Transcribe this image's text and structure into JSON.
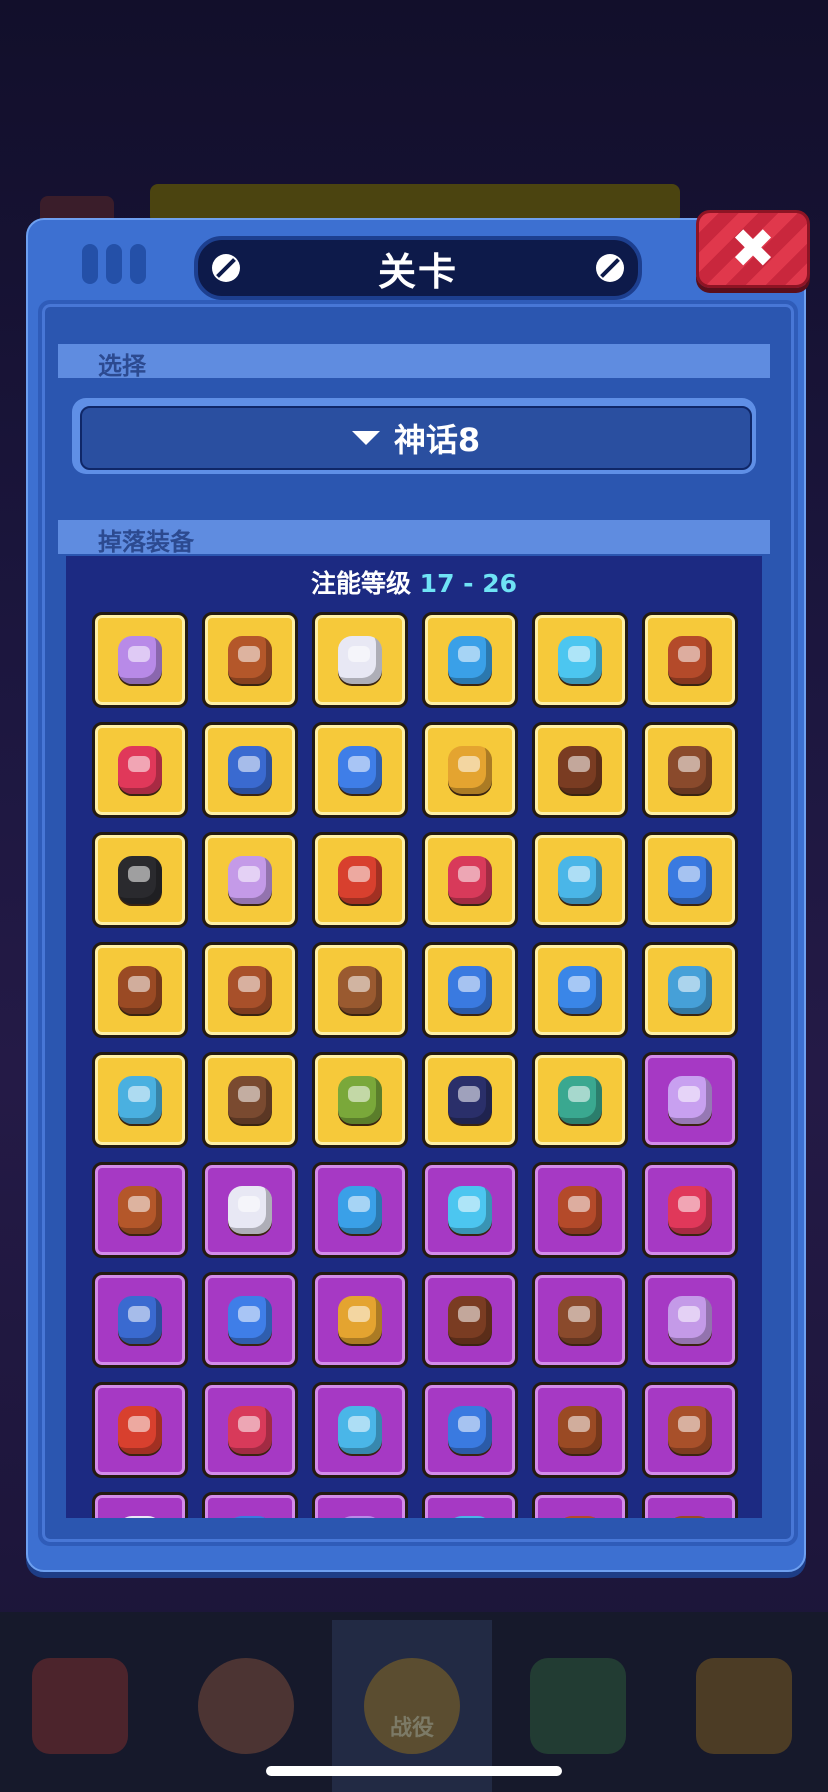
{
  "modal": {
    "title": "关卡",
    "select_section_label": "选择",
    "selected_stage": "神话8",
    "drops_section_label": "掉落装备",
    "level_prefix": "注能等级",
    "level_range": "17 - 26"
  },
  "bottom_nav": {
    "active_label": "战役"
  },
  "items": [
    {
      "icon": "gadget-icon",
      "rarity": "gold",
      "color": "#b88ae8"
    },
    {
      "icon": "shoulder-pad-icon",
      "rarity": "gold",
      "color": "#b4572a"
    },
    {
      "icon": "vest-icon",
      "rarity": "gold",
      "color": "#e8e8f4"
    },
    {
      "icon": "armor-icon",
      "rarity": "gold",
      "color": "#3aa0e8"
    },
    {
      "icon": "goggles-icon",
      "rarity": "gold",
      "color": "#4cc6f0"
    },
    {
      "icon": "cowboy-hat-icon",
      "rarity": "gold",
      "color": "#b44a2a"
    },
    {
      "icon": "headphones-icon",
      "rarity": "gold",
      "color": "#e0385a"
    },
    {
      "icon": "police-cap-icon",
      "rarity": "gold",
      "color": "#3a6ad0"
    },
    {
      "icon": "blue-glove-icon",
      "rarity": "gold",
      "color": "#3f7ee8"
    },
    {
      "icon": "yellow-glove-icon",
      "rarity": "gold",
      "color": "#e4a430"
    },
    {
      "icon": "brown-glove-icon",
      "rarity": "gold",
      "color": "#7a3c22"
    },
    {
      "icon": "brown-glove-icon",
      "rarity": "gold",
      "color": "#8a4a2c"
    },
    {
      "icon": "black-armor-icon",
      "rarity": "gold",
      "color": "#2a2a2e"
    },
    {
      "icon": "purple-jacket-icon",
      "rarity": "gold",
      "color": "#c49ae8"
    },
    {
      "icon": "red-scarf-icon",
      "rarity": "gold",
      "color": "#d8402e"
    },
    {
      "icon": "red-jacket-icon",
      "rarity": "gold",
      "color": "#d83a5a"
    },
    {
      "icon": "blue-shirt-icon",
      "rarity": "gold",
      "color": "#4ab6e8"
    },
    {
      "icon": "blue-boot-icon",
      "rarity": "gold",
      "color": "#3a7ae0"
    },
    {
      "icon": "cowboy-boot-icon",
      "rarity": "gold",
      "color": "#9a4a24"
    },
    {
      "icon": "brown-boot-icon",
      "rarity": "gold",
      "color": "#a8502a"
    },
    {
      "icon": "brown-boot-icon",
      "rarity": "gold",
      "color": "#9a5a30"
    },
    {
      "icon": "blue-shorts-icon",
      "rarity": "gold",
      "color": "#3a7ae0"
    },
    {
      "icon": "blue-shorts-icon",
      "rarity": "gold",
      "color": "#3a86e8"
    },
    {
      "icon": "blue-shorts-icon",
      "rarity": "gold",
      "color": "#46a0d8"
    },
    {
      "icon": "belt-shorts-icon",
      "rarity": "gold",
      "color": "#4ab0e0"
    },
    {
      "icon": "brown-cloak-icon",
      "rarity": "gold",
      "color": "#7a4a30"
    },
    {
      "icon": "green-cloak-icon",
      "rarity": "gold",
      "color": "#7aa83a"
    },
    {
      "icon": "dark-cloak-icon",
      "rarity": "gold",
      "color": "#2a2f6a"
    },
    {
      "icon": "teal-cloak-icon",
      "rarity": "gold",
      "color": "#3aa890"
    },
    {
      "icon": "gadget-icon",
      "rarity": "purple",
      "color": "#c8a0f0"
    },
    {
      "icon": "shoulder-pad-icon",
      "rarity": "purple",
      "color": "#b4572a"
    },
    {
      "icon": "vest-icon",
      "rarity": "purple",
      "color": "#e8e8f4"
    },
    {
      "icon": "armor-icon",
      "rarity": "purple",
      "color": "#3aa0e8"
    },
    {
      "icon": "goggles-icon",
      "rarity": "purple",
      "color": "#4cc6f0"
    },
    {
      "icon": "cowboy-hat-icon",
      "rarity": "purple",
      "color": "#b44a2a"
    },
    {
      "icon": "headphones-icon",
      "rarity": "purple",
      "color": "#e0385a"
    },
    {
      "icon": "police-cap-icon",
      "rarity": "purple",
      "color": "#3a6ad0"
    },
    {
      "icon": "blue-glove-icon",
      "rarity": "purple",
      "color": "#3f7ee8"
    },
    {
      "icon": "yellow-glove-icon",
      "rarity": "purple",
      "color": "#e4a430"
    },
    {
      "icon": "brown-glove-icon",
      "rarity": "purple",
      "color": "#7a3c22"
    },
    {
      "icon": "brown-glove-icon",
      "rarity": "purple",
      "color": "#8a4a2c"
    },
    {
      "icon": "purple-jacket-icon",
      "rarity": "purple",
      "color": "#c49ae8"
    },
    {
      "icon": "red-scarf-icon",
      "rarity": "purple",
      "color": "#d8402e"
    },
    {
      "icon": "red-jacket-icon",
      "rarity": "purple",
      "color": "#d83a5a"
    },
    {
      "icon": "blue-shirt-icon",
      "rarity": "purple",
      "color": "#4ab6e8"
    },
    {
      "icon": "blue-boot-icon",
      "rarity": "purple",
      "color": "#3a7ae0"
    },
    {
      "icon": "cowboy-boot-icon",
      "rarity": "purple",
      "color": "#9a4a24"
    },
    {
      "icon": "brown-boot-icon",
      "rarity": "purple",
      "color": "#a8502a"
    },
    {
      "icon": "partial-item-icon",
      "rarity": "purple",
      "color": "#e8e8f4"
    },
    {
      "icon": "partial-item-icon",
      "rarity": "purple",
      "color": "#3a7ae0"
    },
    {
      "icon": "partial-item-icon",
      "rarity": "purple",
      "color": "#b88ae8"
    },
    {
      "icon": "partial-item-icon",
      "rarity": "purple",
      "color": "#4ab6e8"
    },
    {
      "icon": "partial-item-icon",
      "rarity": "purple",
      "color": "#b44a2a"
    },
    {
      "icon": "partial-item-icon",
      "rarity": "purple",
      "color": "#9a4a24"
    }
  ]
}
